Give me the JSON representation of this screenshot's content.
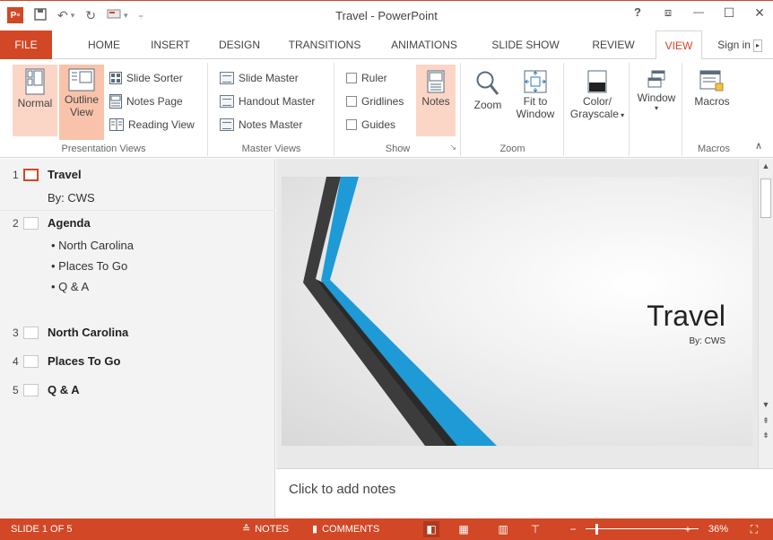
{
  "app": {
    "window_title": "Travel - PowerPoint",
    "logo_text": "P"
  },
  "quick_access": {
    "icons": [
      "save-icon",
      "undo-icon",
      "redo-icon",
      "start-from-beginning-icon",
      "customize-qat-icon"
    ]
  },
  "window_controls": {
    "help": "?",
    "ribbon_display": "⧈",
    "minimize": "—",
    "maximize": "☐",
    "close": "✕"
  },
  "tabs": [
    {
      "label": "FILE"
    },
    {
      "label": "HOME"
    },
    {
      "label": "INSERT"
    },
    {
      "label": "DESIGN"
    },
    {
      "label": "TRANSITIONS"
    },
    {
      "label": "ANIMATIONS"
    },
    {
      "label": "SLIDE SHOW"
    },
    {
      "label": "REVIEW"
    },
    {
      "label": "VIEW"
    }
  ],
  "active_tab": "VIEW",
  "signin": "Sign in",
  "ribbon": {
    "presentation_views": {
      "label": "Presentation Views",
      "normal": "Normal",
      "outline_line1": "Outline",
      "outline_line2": "View",
      "slide_sorter": "Slide Sorter",
      "notes_page": "Notes Page",
      "reading_view": "Reading View"
    },
    "master_views": {
      "label": "Master Views",
      "slide_master": "Slide Master",
      "handout_master": "Handout Master",
      "notes_master": "Notes Master"
    },
    "show": {
      "label": "Show",
      "ruler": "Ruler",
      "gridlines": "Gridlines",
      "guides": "Guides",
      "notes": "Notes"
    },
    "zoom": {
      "label": "Zoom",
      "zoom": "Zoom",
      "fit_line1": "Fit to",
      "fit_line2": "Window"
    },
    "color": {
      "line1": "Color/",
      "line2": "Grayscale"
    },
    "window": {
      "label": "Window"
    },
    "macros": {
      "label": "Macros",
      "button": "Macros"
    }
  },
  "outline": {
    "slides": [
      {
        "number": "1",
        "title": "Travel"
      },
      {
        "number": "2",
        "title": "Agenda"
      },
      {
        "number": "3",
        "title": "North Carolina"
      },
      {
        "number": "4",
        "title": "Places To Go"
      },
      {
        "number": "5",
        "title": "Q & A"
      }
    ],
    "slide1_subtitle": "By: CWS",
    "agenda_bullets": [
      "• North Carolina",
      "• Places To Go",
      "• Q & A"
    ]
  },
  "slide": {
    "title": "Travel",
    "subtitle": "By: CWS"
  },
  "notes": {
    "placeholder": "Click to add notes"
  },
  "status_bar": {
    "slide_indicator": "SLIDE 1 OF 5",
    "notes": "NOTES",
    "comments": "COMMENTS",
    "zoom_percent": "36%",
    "zoom_level": 0.36
  },
  "colors": {
    "accent": "#d24726",
    "highlight": "#fbd6c6",
    "slide_blue": "#1e9ad6",
    "slide_dark": "#3a3a3a"
  }
}
